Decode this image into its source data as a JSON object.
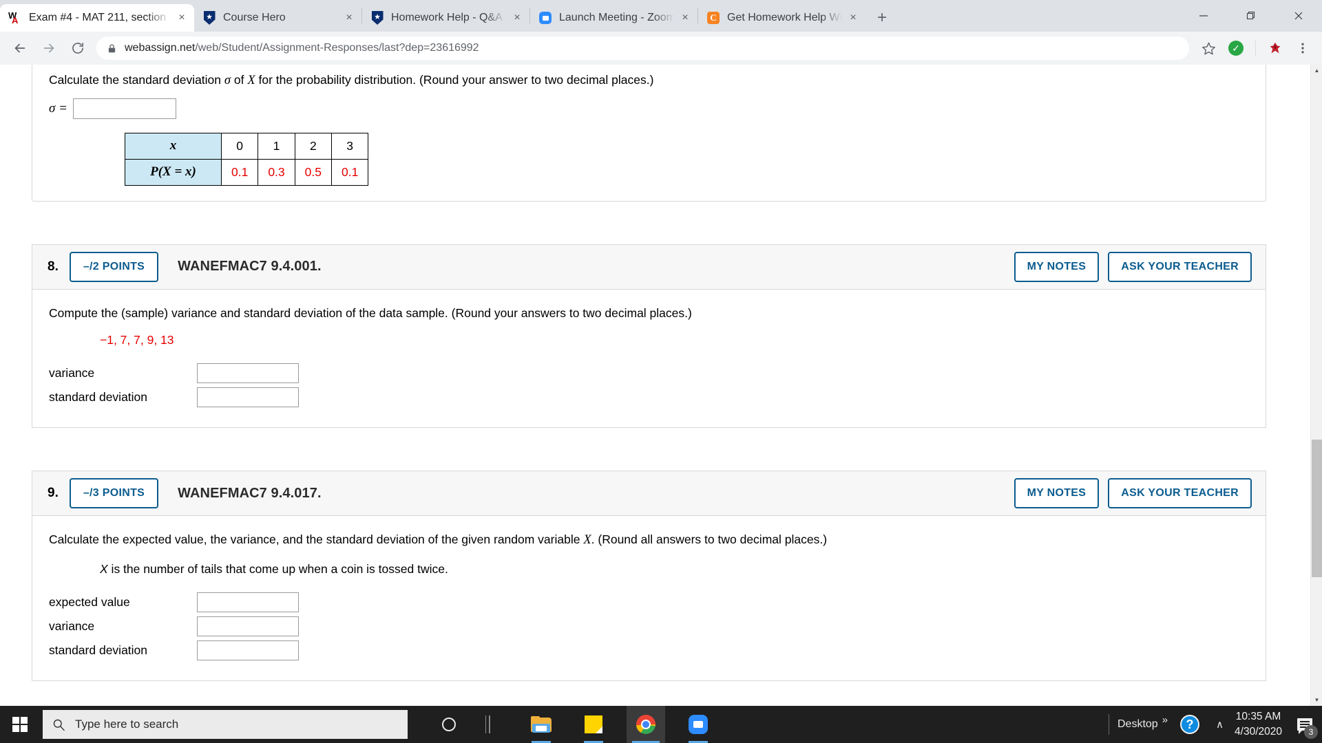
{
  "browser": {
    "tabs": [
      {
        "title": "Exam #4 - MAT 211, section",
        "favicon": "webassign-icon",
        "active": true
      },
      {
        "title": "Course Hero",
        "favicon": "coursehero-icon",
        "active": false
      },
      {
        "title": "Homework Help - Q&A from",
        "favicon": "coursehero-icon",
        "active": false
      },
      {
        "title": "Launch Meeting - Zoom",
        "favicon": "zoom-icon",
        "active": false
      },
      {
        "title": "Get Homework Help With C",
        "favicon": "chegg-icon",
        "active": false
      }
    ],
    "new_tab_label": "+",
    "close_label": "×",
    "window_controls": {
      "minimize": "—",
      "restore": "❐",
      "close": "✕"
    },
    "nav": {
      "back": "←",
      "forward": "→",
      "reload": "⟳"
    },
    "url_domain": "webassign.net",
    "url_path": "/web/Student/Assignment-Responses/last?dep=23616992",
    "toolbar_icons": [
      "star-icon",
      "green-check-extension-icon",
      "extension-avatar-icon",
      "chrome-menu-icon"
    ]
  },
  "page": {
    "partial_question": {
      "prompt_pre": "Calculate the standard deviation ",
      "prompt_sigma": "σ",
      "prompt_mid": " of ",
      "prompt_var": "X",
      "prompt_post": " for the probability distribution. (Round your answer to two decimal places.)",
      "sigma_label": "σ =",
      "answer_value": "",
      "table": {
        "row_headers": [
          "x",
          "P(X = x)"
        ],
        "x_values": [
          "0",
          "1",
          "2",
          "3"
        ],
        "p_values": [
          "0.1",
          "0.3",
          "0.5",
          "0.1"
        ]
      }
    },
    "questions": [
      {
        "number": "8.",
        "points": "–/2 POINTS",
        "code": "WANEFMAC7 9.4.001.",
        "my_notes": "MY NOTES",
        "ask_teacher": "ASK YOUR TEACHER",
        "prompt": "Compute the (sample) variance and standard deviation of the data sample. (Round your answers to two decimal places.)",
        "sample_data": "−1, 7, 7, 9, 13",
        "sub_statement": "",
        "fields": [
          {
            "label": "variance",
            "value": ""
          },
          {
            "label": "standard deviation",
            "value": ""
          }
        ]
      },
      {
        "number": "9.",
        "points": "–/3 POINTS",
        "code": "WANEFMAC7 9.4.017.",
        "my_notes": "MY NOTES",
        "ask_teacher": "ASK YOUR TEACHER",
        "prompt_pre": "Calculate the expected value, the variance, and the standard deviation of the given random variable ",
        "prompt_var": "X",
        "prompt_post": ". (Round all answers to two decimal places.)",
        "sample_data": "",
        "sub_var": "X",
        "sub_statement": " is the number of tails that come up when a coin is tossed twice.",
        "fields": [
          {
            "label": "expected value",
            "value": ""
          },
          {
            "label": "variance",
            "value": ""
          },
          {
            "label": "standard deviation",
            "value": ""
          }
        ]
      }
    ],
    "scrollbar": {
      "up_arrow": "▲",
      "down_arrow": "▼"
    }
  },
  "taskbar": {
    "start": "windows-logo",
    "search_placeholder": "Type here to search",
    "items": [
      {
        "name": "cortana-icon"
      },
      {
        "name": "task-view-icon"
      },
      {
        "name": "file-explorer-icon"
      },
      {
        "name": "sticky-notes-icon"
      },
      {
        "name": "chrome-icon"
      },
      {
        "name": "zoom-icon"
      }
    ],
    "tray": {
      "desktop_label": "Desktop",
      "overflow": "»",
      "help_icon": "?",
      "chevron": "∧",
      "time": "10:35 AM",
      "date": "4/30/2020",
      "notification_count": "3"
    }
  },
  "colors": {
    "accent_blue": "#0b5c8f",
    "red_text": "#e60000",
    "table_header_bg": "#cce8f4",
    "taskbar_bg": "#1f1f1f"
  }
}
